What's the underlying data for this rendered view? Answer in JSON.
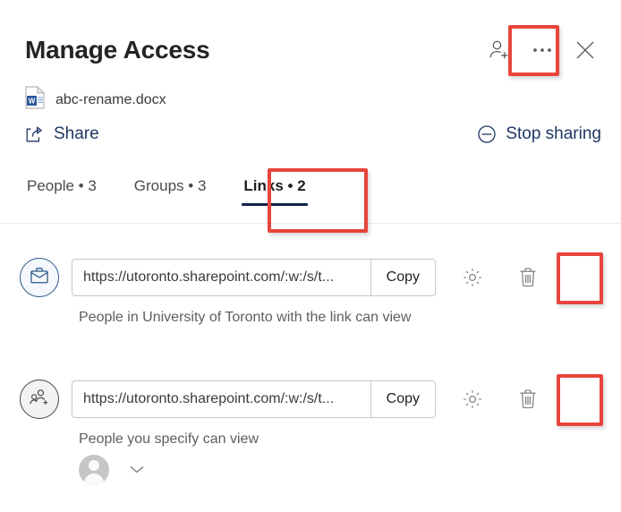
{
  "header": {
    "title": "Manage Access",
    "actions": [
      {
        "name": "add-people-icon",
        "label": "Add people"
      },
      {
        "name": "more-options-icon",
        "label": "More options"
      },
      {
        "name": "close-icon",
        "label": "Close"
      }
    ]
  },
  "file": {
    "icon": "word-document-icon",
    "name": "abc-rename.docx"
  },
  "commands": {
    "share_label": "Share",
    "share_icon": "share-icon",
    "stop_sharing_label": "Stop sharing",
    "stop_sharing_icon": "block-circle-icon"
  },
  "tabs": [
    {
      "label": "People • 3",
      "active": false
    },
    {
      "label": "Groups • 3",
      "active": false
    },
    {
      "label": "Links • 2",
      "active": true
    }
  ],
  "links": [
    {
      "role_icon": "briefcase-icon",
      "url": "https://utoronto.sharepoint.com/:w:/s/t...",
      "copy_label": "Copy",
      "settings_icon": "gear-icon",
      "delete_icon": "trash-icon",
      "description": "People in University of Toronto with the link can view"
    },
    {
      "role_icon": "people-add-icon",
      "url": "https://utoronto.sharepoint.com/:w:/s/t...",
      "copy_label": "Copy",
      "settings_icon": "gear-icon",
      "delete_icon": "trash-icon",
      "description": "People you specify can view",
      "people": [
        {
          "avatar": "default-person-avatar"
        }
      ],
      "expand_icon": "chevron-down-icon"
    }
  ],
  "colors": {
    "annotation": "#e8453c",
    "accent_dark_blue": "#1f3864",
    "tab_underline": "#10214b",
    "word_blue": "#2b579a"
  },
  "annotations": [
    {
      "target": "more-options-icon"
    },
    {
      "target": "tab-links"
    },
    {
      "target": "delete-link-1"
    },
    {
      "target": "delete-link-2"
    }
  ]
}
